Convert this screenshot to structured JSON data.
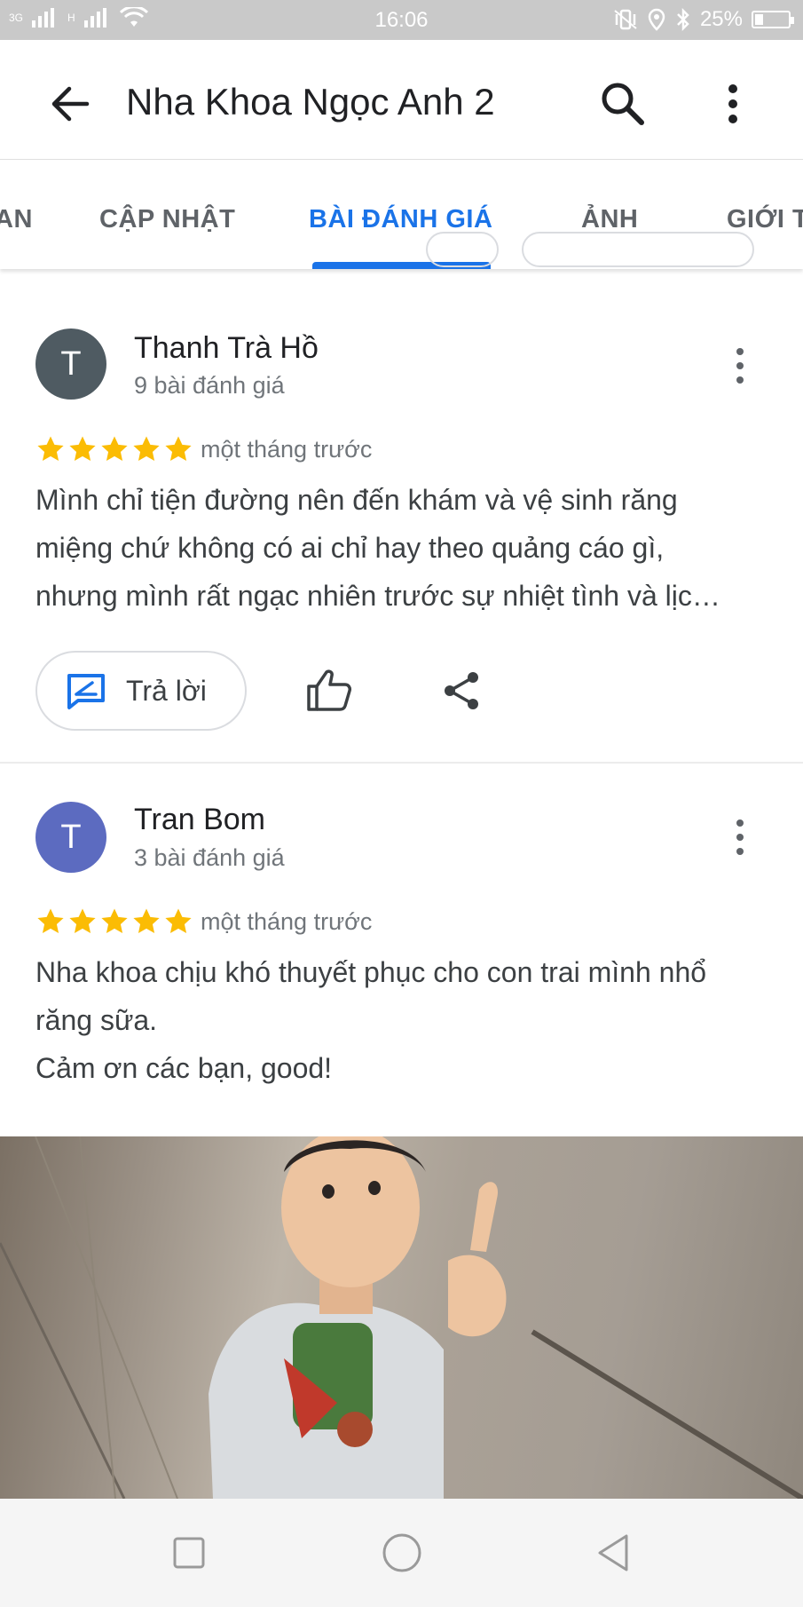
{
  "status_bar": {
    "network": "3G",
    "network2": "H",
    "time": "16:06",
    "battery": "25%",
    "battery_level": 0.25
  },
  "app_bar": {
    "title": "Nha Khoa Ngọc Anh 2"
  },
  "tabs": [
    {
      "label": "AN"
    },
    {
      "label": "CẬP NHẬT"
    },
    {
      "label": "BÀI ĐÁNH GIÁ",
      "active": true
    },
    {
      "label": "ẢNH"
    },
    {
      "label": "GIỚI T"
    }
  ],
  "reviews": [
    {
      "avatar_letter": "T",
      "avatar_color": "#4f5b62",
      "name": "Thanh Trà Hồ",
      "count": "9 bài đánh giá",
      "rating": 5,
      "when": "một tháng trước",
      "text_lines": [
        "Mình chỉ tiện đường nên đến khám và vệ sinh răng",
        "miệng chứ không có ai chỉ hay theo quảng cáo gì,",
        "nhưng mình rất ngạc nhiên trước sự nhiệt tình và lịc…"
      ],
      "reply_label": "Trả lời"
    },
    {
      "avatar_letter": "T",
      "avatar_color": "#5c6bc0",
      "name": "Tran Bom",
      "count": "3 bài đánh giá",
      "rating": 5,
      "when": "một tháng trước",
      "text_lines": [
        "Nha khoa chịu khó thuyết phục cho con trai mình nhổ",
        "răng sữa.",
        "Cảm ơn các bạn,  good!"
      ]
    }
  ],
  "colors": {
    "accent": "#1a73e8",
    "star": "#fbbc04"
  },
  "icons": [
    "back-arrow-icon",
    "search-icon",
    "more-vert-icon",
    "reply-icon",
    "thumb-up-icon",
    "share-icon",
    "nav-recent-icon",
    "nav-home-icon",
    "nav-back-icon"
  ]
}
